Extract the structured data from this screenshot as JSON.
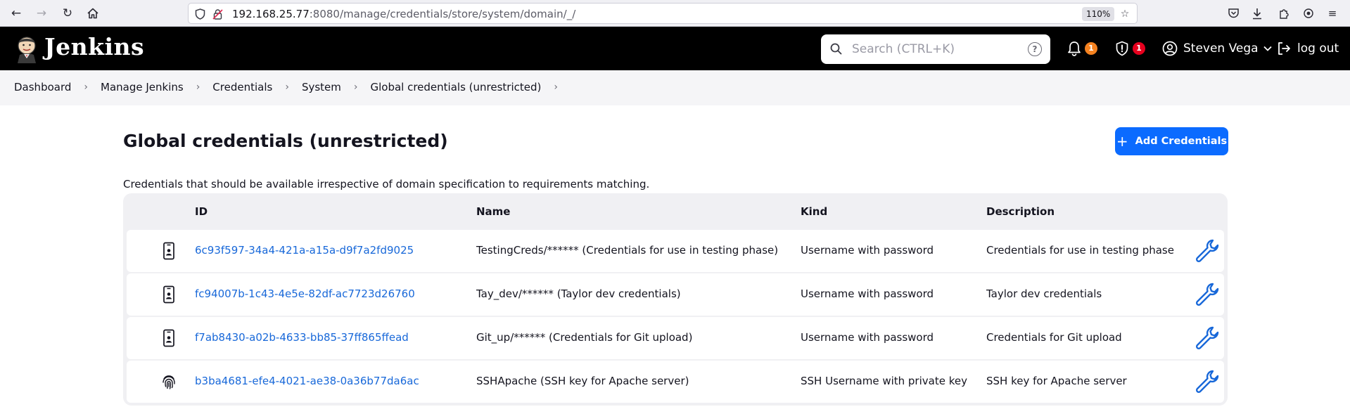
{
  "browser": {
    "url_host": "192.168.25.77",
    "url_rest": ":8080/manage/credentials/store/system/domain/_/",
    "zoom": "110%"
  },
  "header": {
    "app_title": "Jenkins",
    "search_placeholder": "Search (CTRL+K)",
    "notifications_count": "1",
    "security_count": "1",
    "user_name": "Steven Vega",
    "logout_label": "log out"
  },
  "breadcrumbs": [
    "Dashboard",
    "Manage Jenkins",
    "Credentials",
    "System",
    "Global credentials (unrestricted)"
  ],
  "main": {
    "title": "Global credentials (unrestricted)",
    "add_button_label": "Add Credentials",
    "description": "Credentials that should be available irrespective of domain specification to requirements matching."
  },
  "table": {
    "headers": {
      "id": "ID",
      "name": "Name",
      "kind": "Kind",
      "description": "Description"
    },
    "rows": [
      {
        "icon": "id-card-icon",
        "id": "6c93f597-34a4-421a-a15a-d9f7a2fd9025",
        "name": "TestingCreds/****** (Credentials for use in testing phase)",
        "kind": "Username with password",
        "description": "Credentials for use in testing phase"
      },
      {
        "icon": "id-card-icon",
        "id": "fc94007b-1c43-4e5e-82df-ac7723d26760",
        "name": "Tay_dev/****** (Taylor dev credentials)",
        "kind": "Username with password",
        "description": "Taylor dev credentials"
      },
      {
        "icon": "id-card-icon",
        "id": "f7ab8430-a02b-4633-bb85-37ff865ffead",
        "name": "Git_up/****** (Credentials for Git upload)",
        "kind": "Username with password",
        "description": "Credentials for Git upload"
      },
      {
        "icon": "fingerprint-icon",
        "id": "b3ba4681-efe4-4021-ae38-0a36b77da6ac",
        "name": "SSHApache (SSH key for Apache server)",
        "kind": "SSH Username with private key",
        "description": "SSH key for Apache server"
      }
    ]
  },
  "colors": {
    "accent": "#0b6bff",
    "link": "#1868d9",
    "header_bg": "#000000",
    "notif_badge": "#f58220",
    "security_badge": "#e6001e"
  }
}
